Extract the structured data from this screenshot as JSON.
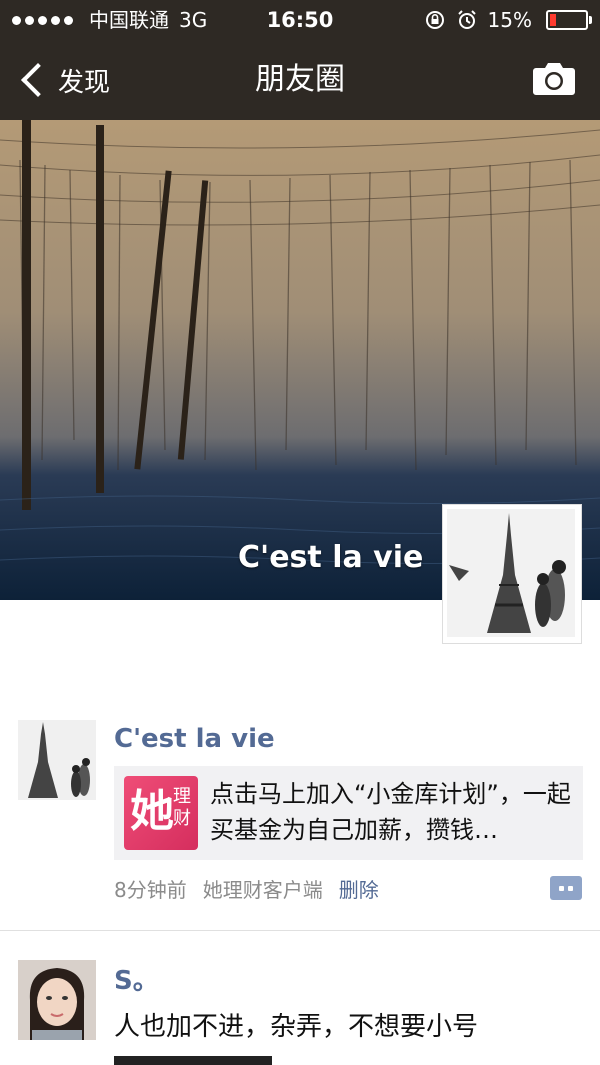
{
  "status_bar": {
    "carrier": "中国联通",
    "network": "3G",
    "time": "16:50",
    "battery": "15%"
  },
  "nav": {
    "back_label": "发现",
    "title": "朋友圈"
  },
  "cover": {
    "name": "C'est la vie"
  },
  "posts": [
    {
      "name": "C'est la vie",
      "share_thumb_big": "她",
      "share_thumb_small": "理财",
      "share_text": "点击马上加入“小金库计划”，一起买基金为自己加薪，攒钱…",
      "time": "8分钟前",
      "source": "她理财客户端",
      "delete_label": "删除"
    },
    {
      "name": "S。",
      "text": "人也加不进，杂弄，不想要小号"
    }
  ],
  "colors": {
    "nav_bg": "#2e2924",
    "link_blue": "#536a94",
    "card_bg": "#f1f1f3"
  }
}
